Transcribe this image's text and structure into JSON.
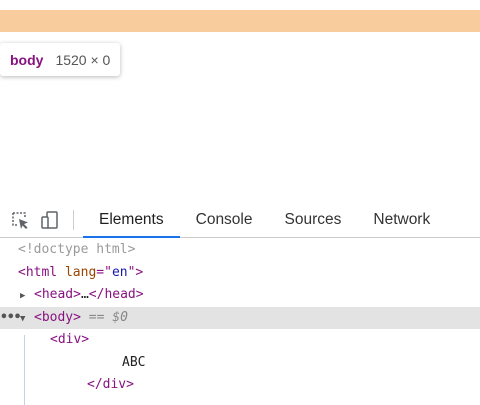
{
  "tooltip": {
    "tag": "body",
    "dimensions": "1520 × 0"
  },
  "toolbar": {
    "icons": [
      "inspect-element-icon",
      "device-toolbar-icon"
    ],
    "tabs": [
      {
        "label": "Elements",
        "active": true
      },
      {
        "label": "Console",
        "active": false
      },
      {
        "label": "Sources",
        "active": false
      },
      {
        "label": "Network",
        "active": false
      }
    ]
  },
  "dom_tree": {
    "doctype": "<!doctype html>",
    "html_open": "<html",
    "html_attr_name": "lang",
    "html_attr_eq": "=\"",
    "html_attr_value": "en",
    "html_attr_close": "\">",
    "head_open": "<head>",
    "head_ellipsis": "…",
    "head_close": "</head>",
    "body_open": "<body>",
    "body_marker": "== $0",
    "div_open": "<div>",
    "div_text": "ABC",
    "div_close": "</div>"
  },
  "colors": {
    "margin_highlight": "#f9cc9d",
    "tag": "#881280",
    "attr_name": "#994500",
    "attr_value": "#1a1aa6",
    "active_tab_underline": "#1a73e8",
    "selected_row": "#e3e3e3"
  }
}
